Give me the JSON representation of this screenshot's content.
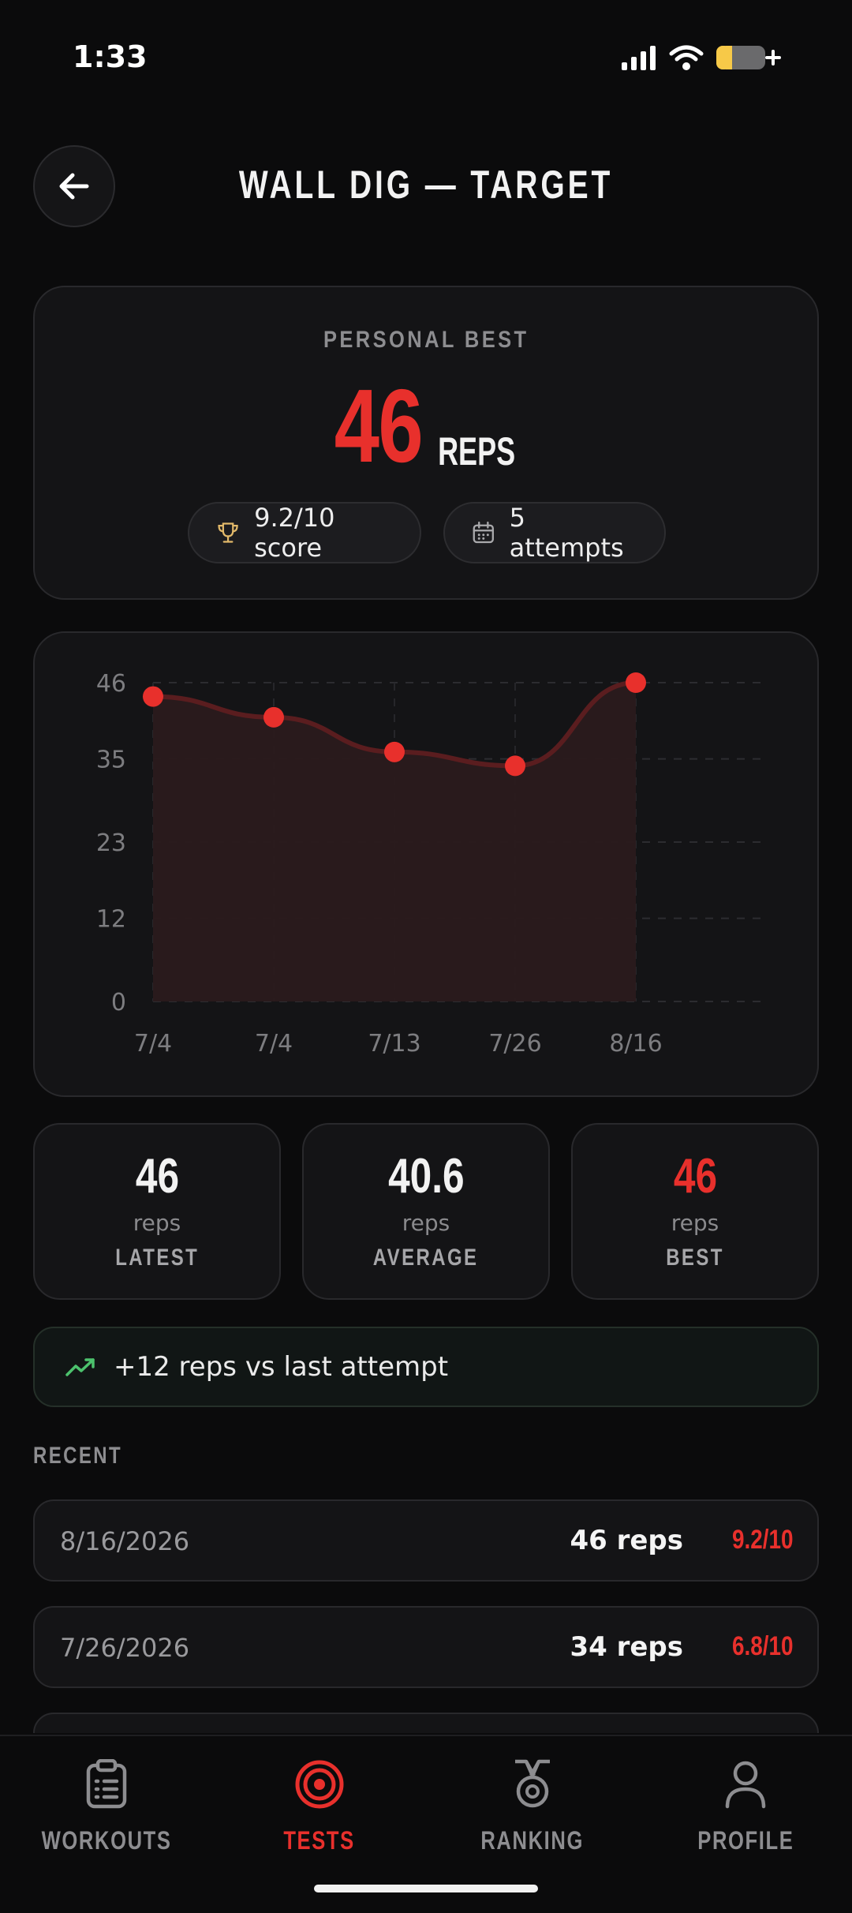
{
  "status_bar": {
    "time": "1:33"
  },
  "header": {
    "title": "WALL DIG — TARGET"
  },
  "personal_best": {
    "label": "PERSONAL BEST",
    "value": "46",
    "unit": "REPS",
    "score_chip": "9.2/10 score",
    "attempts_chip": "5 attempts"
  },
  "chart_data": {
    "type": "area",
    "categories": [
      "7/4",
      "7/4",
      "7/13",
      "7/26",
      "8/16"
    ],
    "values": [
      44,
      41,
      36,
      34,
      46
    ],
    "y_ticks": [
      "46",
      "35",
      "23",
      "12",
      "0"
    ],
    "ylim": [
      0,
      46
    ],
    "grid": true,
    "colors": {
      "line": "#e8302c",
      "fill": "#2a1a1c",
      "point": "#e8302c"
    }
  },
  "stats": [
    {
      "value": "46",
      "unit": "reps",
      "label": "LATEST"
    },
    {
      "value": "40.6",
      "unit": "reps",
      "label": "AVERAGE"
    },
    {
      "value": "46",
      "unit": "reps",
      "label": "BEST"
    }
  ],
  "delta": {
    "text": "+12 reps vs last attempt",
    "icon": "trending-up-icon"
  },
  "recent": {
    "title": "RECENT",
    "rows": [
      {
        "date": "8/16/2026",
        "reps": "46 reps",
        "score": "9.2/10"
      },
      {
        "date": "7/26/2026",
        "reps": "34 reps",
        "score": "6.8/10"
      }
    ]
  },
  "nav": {
    "items": [
      {
        "label": "WORKOUTS",
        "icon": "clipboard-icon"
      },
      {
        "label": "TESTS",
        "icon": "target-icon",
        "active": true
      },
      {
        "label": "RANKING",
        "icon": "medal-icon"
      },
      {
        "label": "PROFILE",
        "icon": "user-icon"
      }
    ]
  },
  "colors": {
    "accent": "#e8302c",
    "background": "#0b0b0c",
    "card": "#141416",
    "positive": "#4cc26d"
  }
}
